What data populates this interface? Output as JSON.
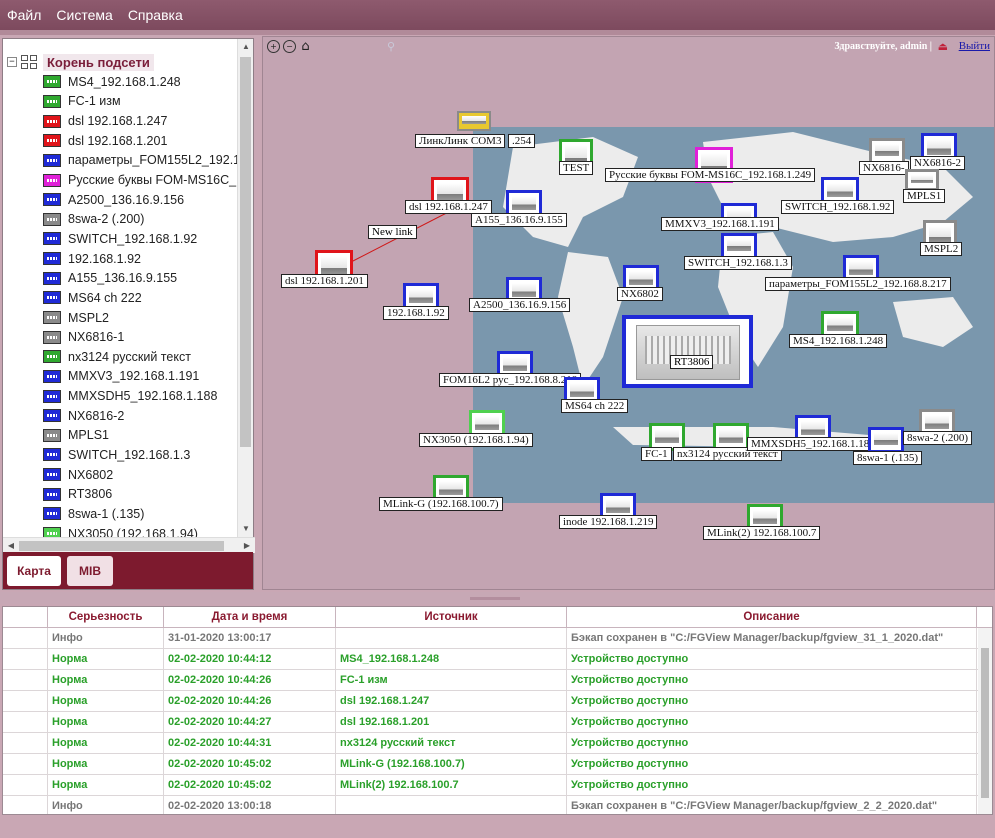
{
  "menu": [
    "Файл",
    "Система",
    "Справка"
  ],
  "tree": {
    "root_label": "Корень подсети",
    "items": [
      {
        "label": "MS4_192.168.1.248",
        "color": "#2fa82f"
      },
      {
        "label": "FC-1 изм",
        "color": "#2fa82f"
      },
      {
        "label": "dsl 192.168.1.247",
        "color": "#e0141a"
      },
      {
        "label": "dsl 192.168.1.201",
        "color": "#e0141a"
      },
      {
        "label": "параметры_FOM155L2_192.1",
        "color": "#1f2ad6"
      },
      {
        "label": "Русские буквы FOM-MS16C_",
        "color": "#e020d8"
      },
      {
        "label": "A2500_136.16.9.156",
        "color": "#1f2ad6"
      },
      {
        "label": "8swa-2 (.200)",
        "color": "#8a8a8a"
      },
      {
        "label": "SWITCH_192.168.1.92",
        "color": "#1f2ad6"
      },
      {
        "label": "192.168.1.92",
        "color": "#1f2ad6"
      },
      {
        "label": "A155_136.16.9.155",
        "color": "#1f2ad6"
      },
      {
        "label": "MS64 ch 222",
        "color": "#1f2ad6"
      },
      {
        "label": "MSPL2",
        "color": "#8a8a8a"
      },
      {
        "label": "NX6816-1",
        "color": "#8a8a8a"
      },
      {
        "label": "nx3124 русский текст",
        "color": "#2fa82f"
      },
      {
        "label": "MMXV3_192.168.1.191",
        "color": "#1f2ad6"
      },
      {
        "label": "MMXSDH5_192.168.1.188",
        "color": "#1f2ad6"
      },
      {
        "label": "NX6816-2",
        "color": "#1f2ad6"
      },
      {
        "label": "MPLS1",
        "color": "#8a8a8a"
      },
      {
        "label": "SWITCH_192.168.1.3",
        "color": "#1f2ad6"
      },
      {
        "label": "NX6802",
        "color": "#1f2ad6"
      },
      {
        "label": "RT3806",
        "color": "#1f2ad6"
      },
      {
        "label": "8swa-1 (.135)",
        "color": "#1f2ad6"
      },
      {
        "label": "NX3050 (192.168.1.94)",
        "color": "#4fd04f"
      }
    ]
  },
  "tabs": {
    "map": "Карта",
    "mib": "MIB"
  },
  "map": {
    "greeting": "Здравствуйте, admin",
    "separator": "|",
    "logout": "Выйти",
    "link_label": "New link",
    "big_node": "RT3806",
    "nodes": {
      "linilink": "ЛинкЛинк COM3",
      "linilink_tail": ".254",
      "test": "TEST",
      "rus": "Русские буквы FOM-MS16C_192.168.1.249",
      "nx6816_1": "NX6816-",
      "nx6816_2": "NX6816-2",
      "mpls1": "MPLS1",
      "dsl247": "dsl 192.168.1.247",
      "a155": "A155_136.16.9.155",
      "mmxv3": "MMXV3_192.168.1.191",
      "switch92": "SWITCH_192.168.1.92",
      "mspl2": "MSPL2",
      "dsl201": "dsl 192.168.1.201",
      "switch3": "SWITCH_192.168.1.3",
      "params": "параметры_FOM155L2_192.168.8.217",
      "ip92": "192.168.1.92",
      "a2500": "A2500_136.16.9.156",
      "nx6802": "NX6802",
      "ms4": "MS4_192.168.1.248",
      "fom16": "FOM16L2 рус_192.168.8.218",
      "ms64": "MS64 ch 222",
      "nx3050": "NX3050 (192.168.1.94)",
      "fc1": "FC-1",
      "nx3124": "nx3124 русский текст",
      "mmxsdh5": "MMXSDH5_192.168.1.18",
      "swa1": "8swa-1 (.135)",
      "swa2": "8swa-2 (.200)",
      "mlinkg": "MLink-G (192.168.100.7)",
      "inode": "inode 192.168.1.219",
      "mlink2": "MLink(2) 192.168.100.7"
    }
  },
  "events": {
    "headers": [
      "Серьезность",
      "Дата и время",
      "Источник",
      "Описание"
    ],
    "rows": [
      {
        "sev": "Инфо",
        "dt": "31-01-2020 13:00:17",
        "src": "",
        "desc": "Бэкап сохранен в \"C:/FGView Manager/backup/fgview_31_1_2020.dat\"",
        "kind": "info"
      },
      {
        "sev": "Норма",
        "dt": "02-02-2020 10:44:12",
        "src": "MS4_192.168.1.248",
        "desc": "Устройство доступно",
        "kind": "ok"
      },
      {
        "sev": "Норма",
        "dt": "02-02-2020 10:44:26",
        "src": "FC-1 изм",
        "desc": "Устройство доступно",
        "kind": "ok"
      },
      {
        "sev": "Норма",
        "dt": "02-02-2020 10:44:26",
        "src": "dsl 192.168.1.247",
        "desc": "Устройство доступно",
        "kind": "ok"
      },
      {
        "sev": "Норма",
        "dt": "02-02-2020 10:44:27",
        "src": "dsl 192.168.1.201",
        "desc": "Устройство доступно",
        "kind": "ok"
      },
      {
        "sev": "Норма",
        "dt": "02-02-2020 10:44:31",
        "src": "nx3124 русский текст",
        "desc": "Устройство доступно",
        "kind": "ok"
      },
      {
        "sev": "Норма",
        "dt": "02-02-2020 10:45:02",
        "src": "MLink-G (192.168.100.7)",
        "desc": "Устройство доступно",
        "kind": "ok"
      },
      {
        "sev": "Норма",
        "dt": "02-02-2020 10:45:02",
        "src": "MLink(2) 192.168.100.7",
        "desc": "Устройство доступно",
        "kind": "ok"
      },
      {
        "sev": "Инфо",
        "dt": "02-02-2020 13:00:18",
        "src": "",
        "desc": "Бэкап сохранен в \"C:/FGView Manager/backup/fgview_2_2_2020.dat\"",
        "kind": "info"
      }
    ]
  },
  "icons": [
    "zoom-in-icon",
    "zoom-out-icon",
    "home-icon",
    "logout-icon",
    "expander-icon",
    "subnet-root-icon"
  ]
}
